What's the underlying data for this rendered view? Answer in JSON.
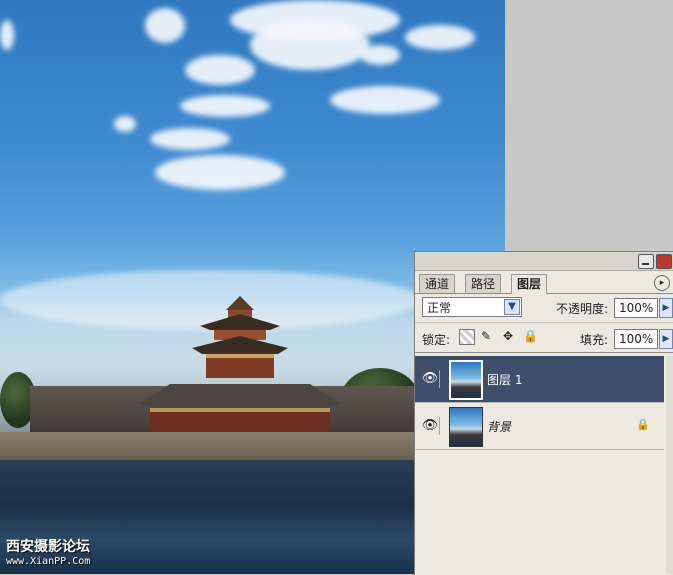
{
  "watermark": {
    "line1": "西安摄影论坛",
    "line2": "www.XianPP.Com"
  },
  "layers_panel": {
    "tabs": [
      {
        "label": "通道",
        "active": false
      },
      {
        "label": "路径",
        "active": false
      },
      {
        "label": "图层",
        "active": true
      }
    ],
    "blend_mode": "正常",
    "opacity_label": "不透明度:",
    "opacity_value": "100%",
    "lock_label": "锁定:",
    "lock_icons": [
      "transparency-lock-icon",
      "brush-lock-icon",
      "move-lock-icon",
      "padlock-icon"
    ],
    "fill_label": "填充:",
    "fill_value": "100%",
    "layers": [
      {
        "name": "图层 1",
        "selected": true,
        "visible": true,
        "locked": false
      },
      {
        "name": "背景",
        "selected": false,
        "visible": true,
        "locked": true
      }
    ]
  },
  "colors": {
    "panel_bg": "#ebe9e0",
    "selected_layer": "#404e6b",
    "workspace_grey": "#c8c8c8"
  }
}
